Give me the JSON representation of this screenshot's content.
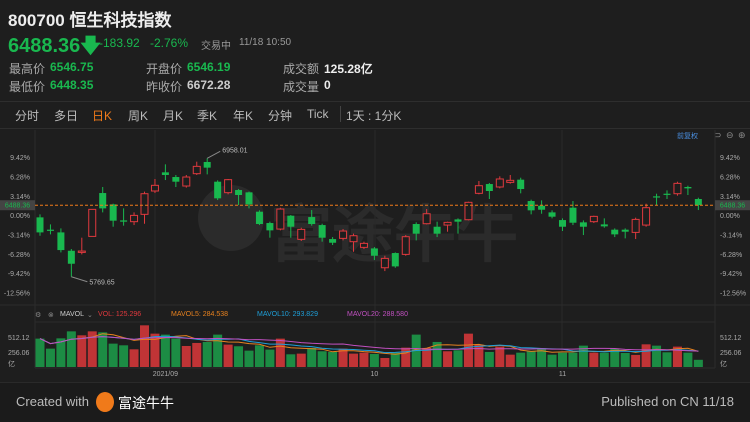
{
  "header": {
    "title": "800700 恒生科技指数",
    "price": "6488.36",
    "change": "-183.92",
    "change_pct": "-2.76%",
    "status": "交易中",
    "time": "11/18 10:50"
  },
  "stats": {
    "high_label": "最高价",
    "high": "6546.75",
    "low_label": "最低价",
    "low": "6448.35",
    "open_label": "开盘价",
    "open": "6546.19",
    "prev_label": "昨收价",
    "prev": "6672.28",
    "turnover_label": "成交额",
    "turnover": "125.28亿",
    "volume_label": "成交量",
    "volume": "0"
  },
  "tabs": [
    {
      "label": "分时"
    },
    {
      "label": "多日"
    },
    {
      "label": "日K",
      "active": true
    },
    {
      "label": "周K"
    },
    {
      "label": "月K"
    },
    {
      "label": "季K"
    },
    {
      "label": "年K"
    },
    {
      "label": "分钟"
    },
    {
      "label": "Tick"
    }
  ],
  "interval": "1天 : 1分K",
  "adjust_label": "前复权",
  "watermark": "富途牛牛",
  "colors": {
    "up": "#e0393e",
    "down": "#19b84f",
    "price_line": "#f07a1a",
    "mavol5": "#e8821e",
    "mavol10": "#1e9fd8",
    "mavol20": "#c050c0"
  },
  "chart_data": {
    "type": "candlestick",
    "y_ticks": [
      "9.42%",
      "6.28%",
      "3.14%",
      "0.00%",
      "-3.14%",
      "-6.28%",
      "-9.42%",
      "-12.56%"
    ],
    "y_tick_values": [
      9.42,
      6.28,
      3.14,
      0,
      -3.14,
      -6.28,
      -9.42,
      -12.56
    ],
    "current_price_label": "6488.36",
    "current_price_pct": 1.7,
    "high_label": "6958.01",
    "low_label": "5769.65",
    "x_labels": [
      {
        "label": "2021/09",
        "index": 12
      },
      {
        "label": "10",
        "index": 32
      },
      {
        "label": "11",
        "index": 50
      }
    ],
    "candles": [
      [
        -0.27,
        0.22,
        -3.25,
        -2.71
      ],
      [
        -2.27,
        -1.41,
        -3.03,
        -2.38
      ],
      [
        -2.71,
        -2.06,
        -5.96,
        -5.58
      ],
      [
        -5.69,
        -5.41,
        -9.91,
        -7.8
      ],
      [
        -5.96,
        -3.57,
        -6.28,
        -5.74
      ],
      [
        -3.36,
        1.03,
        -3.36,
        1.03
      ],
      [
        3.68,
        4.66,
        0.54,
        1.19
      ],
      [
        1.84,
        1.95,
        -1.79,
        -0.81
      ],
      [
        -0.76,
        1.19,
        -1.62,
        -0.97
      ],
      [
        -0.97,
        0.54,
        -1.52,
        0.05
      ],
      [
        0.22,
        3.9,
        -1.3,
        3.57
      ],
      [
        4.01,
        5.96,
        3.68,
        4.93
      ],
      [
        7.04,
        8.34,
        5.79,
        6.61
      ],
      [
        6.28,
        6.61,
        4.66,
        5.52
      ],
      [
        4.82,
        6.61,
        4.55,
        6.28
      ],
      [
        6.82,
        8.77,
        6.61,
        8.01
      ],
      [
        8.72,
        9.31,
        6.71,
        7.8
      ],
      [
        5.52,
        5.74,
        2.54,
        2.82
      ],
      [
        3.74,
        5.96,
        3.47,
        5.85
      ],
      [
        4.17,
        4.33,
        1.73,
        3.36
      ],
      [
        3.79,
        3.9,
        1.19,
        1.84
      ],
      [
        0.65,
        0.87,
        -1.52,
        -1.35
      ],
      [
        -1.19,
        -0.97,
        -3.57,
        -2.38
      ],
      [
        -2.17,
        1.3,
        -2.38,
        1.08
      ],
      [
        0,
        0.11,
        -3.57,
        -1.79
      ],
      [
        -3.84,
        -1.95,
        -4.11,
        -2.22
      ],
      [
        -0.22,
        0.92,
        -1.62,
        -1.35
      ],
      [
        -1.52,
        -1.3,
        -4.22,
        -3.57
      ],
      [
        -3.79,
        -3.47,
        -4.76,
        -4.39
      ],
      [
        -3.68,
        -2.17,
        -4.01,
        -2.49
      ],
      [
        -4.22,
        -2.92,
        -5.85,
        -3.25
      ],
      [
        -5.14,
        -4.22,
        -5.41,
        -4.49
      ],
      [
        -5.31,
        -5.09,
        -7.2,
        -6.5
      ],
      [
        -8.45,
        -6.5,
        -8.99,
        -6.93
      ],
      [
        -6.06,
        -5.96,
        -8.45,
        -8.23
      ],
      [
        -6.28,
        -3.14,
        -6.5,
        -3.41
      ],
      [
        -1.35,
        -1.08,
        -4.01,
        -2.92
      ],
      [
        -1.3,
        1.08,
        -1.41,
        0.32
      ],
      [
        -1.79,
        -0.97,
        -3.47,
        -2.92
      ],
      [
        -1.52,
        -0.97,
        -2.6,
        -1.08
      ],
      [
        -0.6,
        -0.43,
        -2.92,
        -0.97
      ],
      [
        -0.65,
        2.27,
        -0.76,
        2.17
      ],
      [
        3.63,
        5.63,
        3.47,
        4.87
      ],
      [
        5.14,
        5.31,
        2.71,
        4.01
      ],
      [
        4.66,
        6.39,
        4.44,
        5.96
      ],
      [
        5.41,
        6.61,
        5.2,
        5.74
      ],
      [
        5.85,
        6.17,
        3.63,
        4.33
      ],
      [
        2.38,
        2.6,
        0.22,
        0.87
      ],
      [
        1.62,
        2.49,
        0.32,
        0.97
      ],
      [
        0.54,
        0.87,
        -0.43,
        -0.16
      ],
      [
        -0.71,
        -0.43,
        -2.49,
        -1.79
      ],
      [
        1.3,
        2.38,
        -1.52,
        -1.14
      ],
      [
        -1.08,
        -0.76,
        -3.14,
        -1.79
      ],
      [
        -0.97,
        0,
        -1.19,
        -0.11
      ],
      [
        -1.41,
        -0.43,
        -1.95,
        -1.73
      ],
      [
        -2.27,
        -2.06,
        -3.47,
        -3.03
      ],
      [
        -2.27,
        -2.06,
        -3.68,
        -2.6
      ],
      [
        -2.71,
        -0.32,
        -3.79,
        -0.6
      ],
      [
        -1.52,
        1.95,
        -1.79,
        1.3
      ],
      [
        3.14,
        3.57,
        1.73,
        2.98
      ],
      [
        3.57,
        4.11,
        2.71,
        3.41
      ],
      [
        3.57,
        5.52,
        3.25,
        5.25
      ],
      [
        4.66,
        4.87,
        3.36,
        4.44
      ],
      [
        2.71,
        2.92,
        0.92,
        1.73
      ]
    ],
    "volume": {
      "unit": "亿",
      "y_ticks": [
        "512.12",
        "256.06"
      ],
      "y_tick_values": [
        512.12,
        256.06
      ],
      "values": [
        494,
        320,
        499,
        621,
        552,
        621,
        604,
        407,
        378,
        308,
        726,
        581,
        564,
        494,
        366,
        419,
        436,
        564,
        390,
        361,
        285,
        378,
        303,
        494,
        221,
        233,
        332,
        274,
        262,
        320,
        233,
        250,
        227,
        157,
        250,
        337,
        564,
        332,
        436,
        274,
        291,
        581,
        390,
        262,
        355,
        215,
        250,
        274,
        326,
        215,
        250,
        250,
        372,
        250,
        250,
        320,
        244,
        210,
        395,
        372,
        256,
        355,
        250,
        125.3
      ]
    },
    "indicators": {
      "name": "MAVOL",
      "vol": "VOL: 125.296",
      "mavol5": "MAVOL5: 284.538",
      "mavol10": "MAVOL10: 293.829",
      "mavol20": "MAVOL20: 288.580"
    }
  },
  "footer": {
    "created_with": "Created with",
    "brand": "富途牛牛",
    "published": "Published on CN 11/18"
  }
}
